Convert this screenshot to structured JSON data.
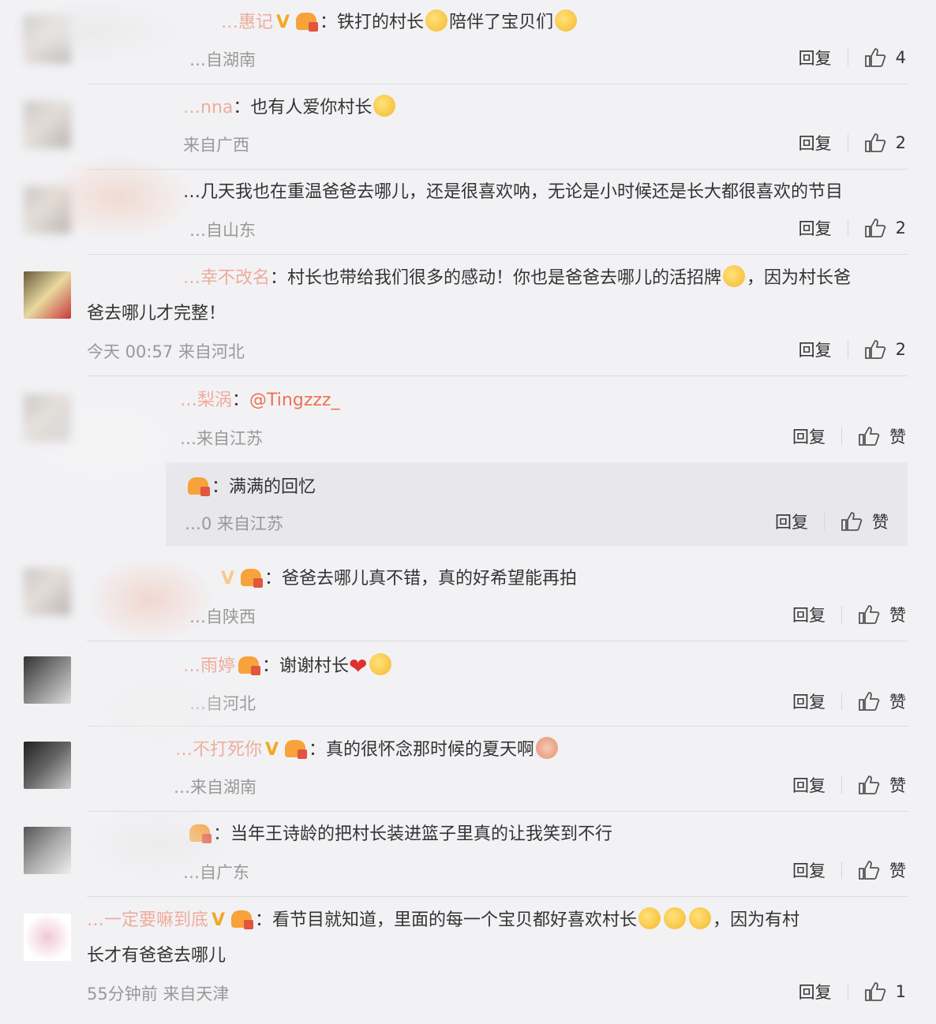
{
  "comments": [
    {
      "user": "…惠记",
      "text": "：铁打的村长",
      "text2": "陪伴了宝贝们",
      "meta": "…自湖南",
      "reply": "回复",
      "likes": "4"
    },
    {
      "user": "…nna",
      "text": "：也有人爱你村长",
      "meta": "来自广西",
      "reply": "回复",
      "likes": "2"
    },
    {
      "user": "",
      "text": "…几天我也在重温爸爸去哪儿，还是很喜欢呐，无论是小时候还是长大都很喜欢的节目",
      "meta": "…自山东",
      "reply": "回复",
      "likes": "2"
    },
    {
      "user": "…幸不改名",
      "text": "：村长也带给我们很多的感动！你也是爸爸去哪儿的活招牌",
      "text2": "，因为村长爸",
      "text3": "爸去哪儿才完整！",
      "meta": "今天 00:57 来自河北",
      "reply": "回复",
      "likes": "2"
    },
    {
      "user": "…梨涡",
      "mention": "@Tingzzz_",
      "meta": "…来自江苏",
      "reply": "回复",
      "likes": "赞"
    },
    {
      "user": "",
      "text": "：满满的回忆",
      "meta": "…0 来自江苏",
      "reply": "回复",
      "likes": "赞"
    },
    {
      "user": "",
      "text": "：爸爸去哪儿真不错，真的好希望能再拍",
      "meta": "…自陕西",
      "reply": "回复",
      "likes": "赞"
    },
    {
      "user": "…雨婷",
      "text": "：谢谢村长",
      "meta": "…自河北",
      "reply": "回复",
      "likes": "赞"
    },
    {
      "user": "…不打死你",
      "text": "：真的很怀念那时候的夏天啊",
      "meta": "…来自湖南",
      "reply": "回复",
      "likes": "赞"
    },
    {
      "user": "",
      "text": "：当年王诗龄的把村长装进篮子里真的让我笑到不行",
      "meta": "…自广东",
      "reply": "回复",
      "likes": "赞"
    },
    {
      "user": "…一定要嘛到底",
      "text": "：看节目就知道，里面的每一个宝贝都好喜欢村长",
      "text2": "，因为有村",
      "text3": "长才有爸爸去哪儿",
      "meta": "55分钟前 来自天津",
      "reply": "回复",
      "likes": "1"
    }
  ],
  "colors": {
    "accent": "#eb7350",
    "badge": "#f5a623"
  }
}
